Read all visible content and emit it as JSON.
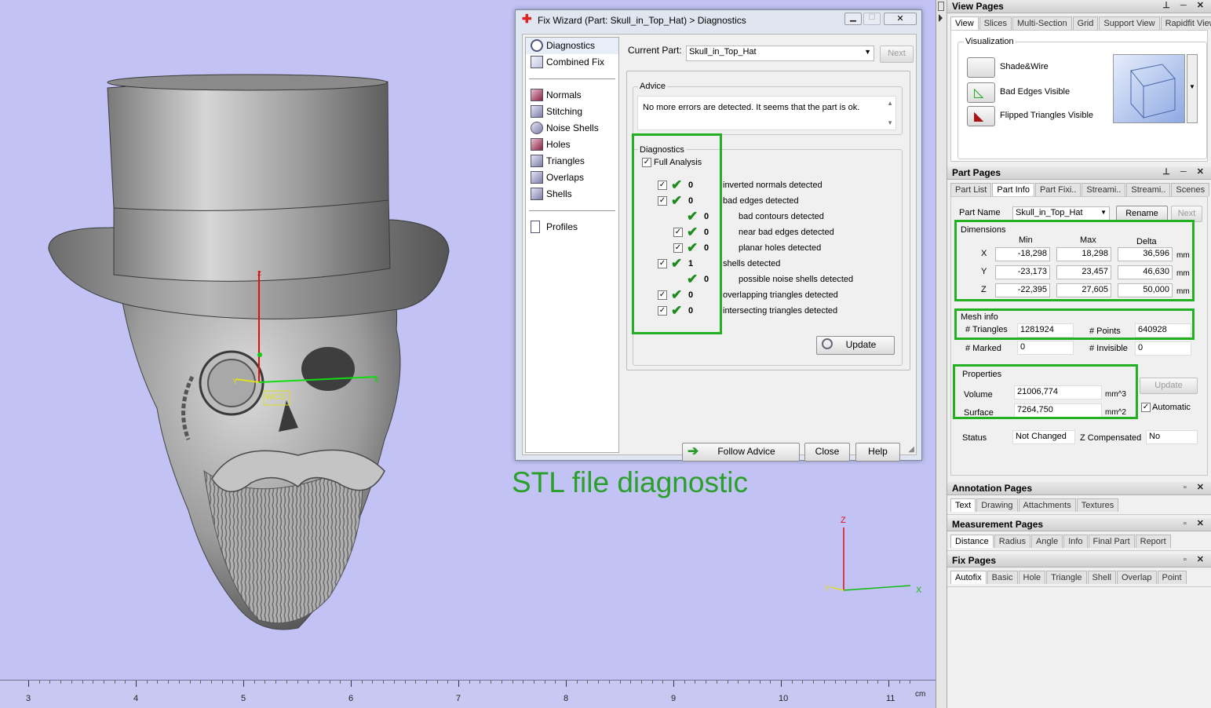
{
  "viewport": {
    "caption": "STL file diagnostic",
    "axis_z": "z",
    "axis_y": "Y",
    "axis_x": "X",
    "wcs": "WCS",
    "triad_z": "Z",
    "triad_y": "Y",
    "triad_x": "X",
    "ruler": {
      "labels": [
        "3",
        "4",
        "5",
        "6",
        "7",
        "8",
        "9",
        "10",
        "11"
      ],
      "unit": "cm"
    }
  },
  "fixwizard": {
    "title": "Fix Wizard (Part: Skull_in_Top_Hat) > Diagnostics",
    "nav": {
      "diagnostics": "Diagnostics",
      "combined_fix": "Combined Fix",
      "normals": "Normals",
      "stitching": "Stitching",
      "noise_shells": "Noise Shells",
      "holes": "Holes",
      "triangles": "Triangles",
      "overlaps": "Overlaps",
      "shells": "Shells",
      "profiles": "Profiles"
    },
    "current_part_label": "Current Part:",
    "current_part_value": "Skull_in_Top_Hat",
    "next_label": "Next",
    "advice_title": "Advice",
    "advice_text": "No more errors are detected. It seems that the part is ok.",
    "diagnostics_title": "Diagnostics",
    "full_analysis": "Full Analysis",
    "rows": [
      {
        "count": "0",
        "text": "inverted normals detected"
      },
      {
        "count": "0",
        "text": "bad edges detected"
      },
      {
        "count": "0",
        "text": "bad contours detected"
      },
      {
        "count": "0",
        "text": "near bad edges detected"
      },
      {
        "count": "0",
        "text": "planar holes detected"
      },
      {
        "count": "1",
        "text": "shells detected"
      },
      {
        "count": "0",
        "text": "possible noise shells detected"
      },
      {
        "count": "0",
        "text": "overlapping triangles detected"
      },
      {
        "count": "0",
        "text": "intersecting triangles detected"
      }
    ],
    "update_label": "Update",
    "follow_advice": "Follow Advice",
    "close": "Close",
    "help": "Help"
  },
  "view_pages": {
    "title": "View Pages",
    "tabs": [
      "View",
      "Slices",
      "Multi-Section",
      "Grid",
      "Support View",
      "Rapidfit View"
    ],
    "visualization": "Visualization",
    "shade_wire": "Shade&Wire",
    "bad_edges": "Bad Edges Visible",
    "flipped": "Flipped Triangles Visible"
  },
  "part_pages": {
    "title": "Part Pages",
    "tabs": [
      "Part List",
      "Part Info",
      "Part Fixi..",
      "Streami..",
      "Streami..",
      "Scenes"
    ],
    "part_name_label": "Part Name",
    "part_name_value": "Skull_in_Top_Hat",
    "rename": "Rename",
    "next": "Next",
    "dimensions": "Dimensions",
    "col_min": "Min",
    "col_max": "Max",
    "col_delta": "Delta",
    "dims": [
      {
        "axis": "X",
        "min": "-18,298",
        "max": "18,298",
        "delta": "36,596",
        "unit": "mm"
      },
      {
        "axis": "Y",
        "min": "-23,173",
        "max": "23,457",
        "delta": "46,630",
        "unit": "mm"
      },
      {
        "axis": "Z",
        "min": "-22,395",
        "max": "27,605",
        "delta": "50,000",
        "unit": "mm"
      }
    ],
    "mesh_info": "Mesh info",
    "triangles_label": "# Triangles",
    "triangles_value": "1281924",
    "points_label": "# Points",
    "points_value": "640928",
    "marked_label": "# Marked",
    "marked_value": "0",
    "invisible_label": "# Invisible",
    "invisible_value": "0",
    "properties": "Properties",
    "volume_label": "Volume",
    "volume_value": "21006,774",
    "volume_unit": "mm^3",
    "surface_label": "Surface",
    "surface_value": "7264,750",
    "surface_unit": "mm^2",
    "update": "Update",
    "automatic": "Automatic",
    "status_label": "Status",
    "status_value": "Not Changed",
    "zcomp_label": "Z Compensated",
    "zcomp_value": "No"
  },
  "annotation_pages": {
    "title": "Annotation Pages",
    "tabs": [
      "Text",
      "Drawing",
      "Attachments",
      "Textures"
    ]
  },
  "measurement_pages": {
    "title": "Measurement Pages",
    "tabs": [
      "Distance",
      "Radius",
      "Angle",
      "Info",
      "Final Part",
      "Report"
    ]
  },
  "fix_pages": {
    "title": "Fix Pages",
    "tabs": [
      "Autofix",
      "Basic",
      "Hole",
      "Triangle",
      "Shell",
      "Overlap",
      "Point"
    ]
  }
}
